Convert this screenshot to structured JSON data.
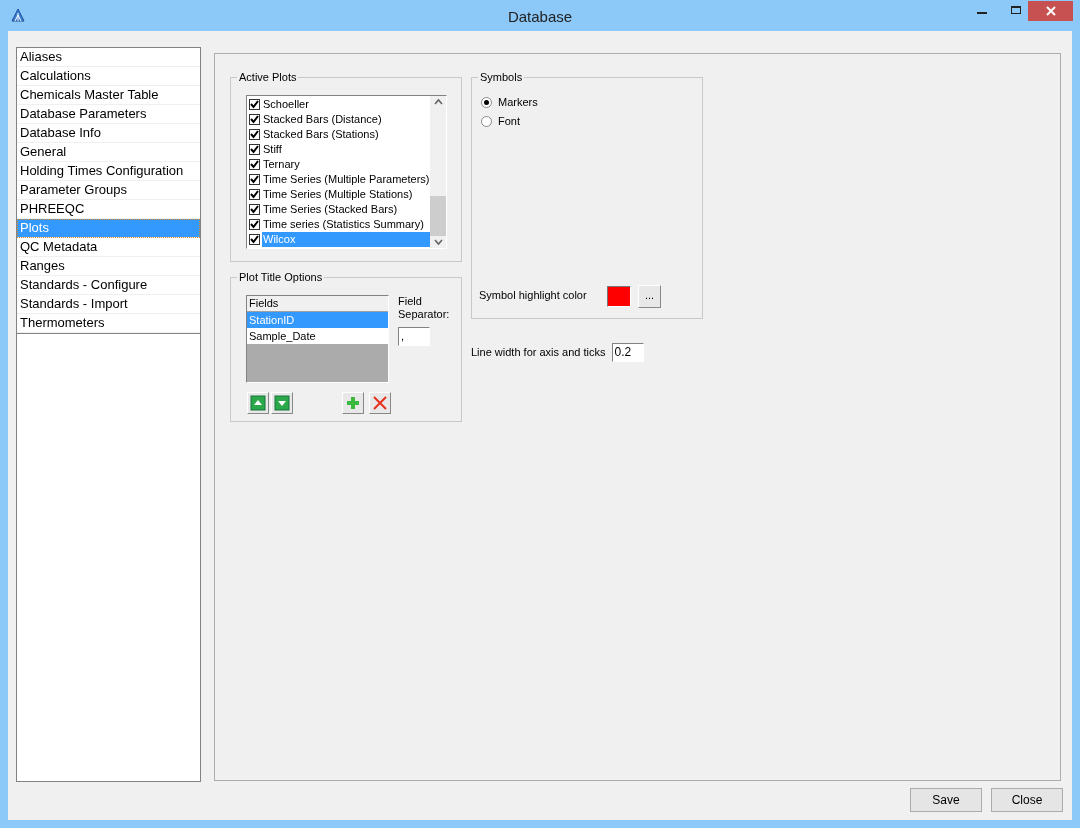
{
  "window": {
    "title": "Database"
  },
  "sidebar": {
    "items": [
      {
        "label": "Aliases",
        "selected": false
      },
      {
        "label": "Calculations",
        "selected": false
      },
      {
        "label": "Chemicals Master Table",
        "selected": false
      },
      {
        "label": "Database Parameters",
        "selected": false
      },
      {
        "label": "Database Info",
        "selected": false
      },
      {
        "label": "General",
        "selected": false
      },
      {
        "label": "Holding Times Configuration",
        "selected": false
      },
      {
        "label": "Parameter Groups",
        "selected": false
      },
      {
        "label": "PHREEQC",
        "selected": false
      },
      {
        "label": "Plots",
        "selected": true
      },
      {
        "label": "QC Metadata",
        "selected": false
      },
      {
        "label": "Ranges",
        "selected": false
      },
      {
        "label": "Standards - Configure",
        "selected": false
      },
      {
        "label": "Standards - Import",
        "selected": false
      },
      {
        "label": "Thermometers",
        "selected": false
      }
    ]
  },
  "active_plots": {
    "title": "Active Plots",
    "items": [
      {
        "label": "Schoeller",
        "checked": true,
        "selected": false
      },
      {
        "label": "Stacked Bars (Distance)",
        "checked": true,
        "selected": false
      },
      {
        "label": "Stacked Bars (Stations)",
        "checked": true,
        "selected": false
      },
      {
        "label": "Stiff",
        "checked": true,
        "selected": false
      },
      {
        "label": "Ternary",
        "checked": true,
        "selected": false
      },
      {
        "label": "Time Series (Multiple Parameters)",
        "checked": true,
        "selected": false
      },
      {
        "label": "Time Series (Multiple Stations)",
        "checked": true,
        "selected": false
      },
      {
        "label": "Time Series (Stacked Bars)",
        "checked": true,
        "selected": false
      },
      {
        "label": "Time series (Statistics Summary)",
        "checked": true,
        "selected": false
      },
      {
        "label": "Wilcox",
        "checked": true,
        "selected": true
      }
    ]
  },
  "plot_title_options": {
    "title": "Plot Title Options",
    "fields_header": "Fields",
    "fields": [
      {
        "label": "StationID",
        "selected": true
      },
      {
        "label": "Sample_Date",
        "selected": false
      }
    ],
    "separator_label": "Field Separator:",
    "separator_value": ","
  },
  "symbols": {
    "title": "Symbols",
    "options": [
      {
        "label": "Markers",
        "selected": true
      },
      {
        "label": "Font",
        "selected": false
      }
    ],
    "highlight_label": "Symbol highlight color",
    "highlight_swatch": {
      "color": "#ff0000"
    },
    "browse_button": "..."
  },
  "line_width": {
    "label": "Line width for axis and ticks",
    "value": "0.2"
  },
  "buttons": [
    "Save",
    "Close"
  ]
}
